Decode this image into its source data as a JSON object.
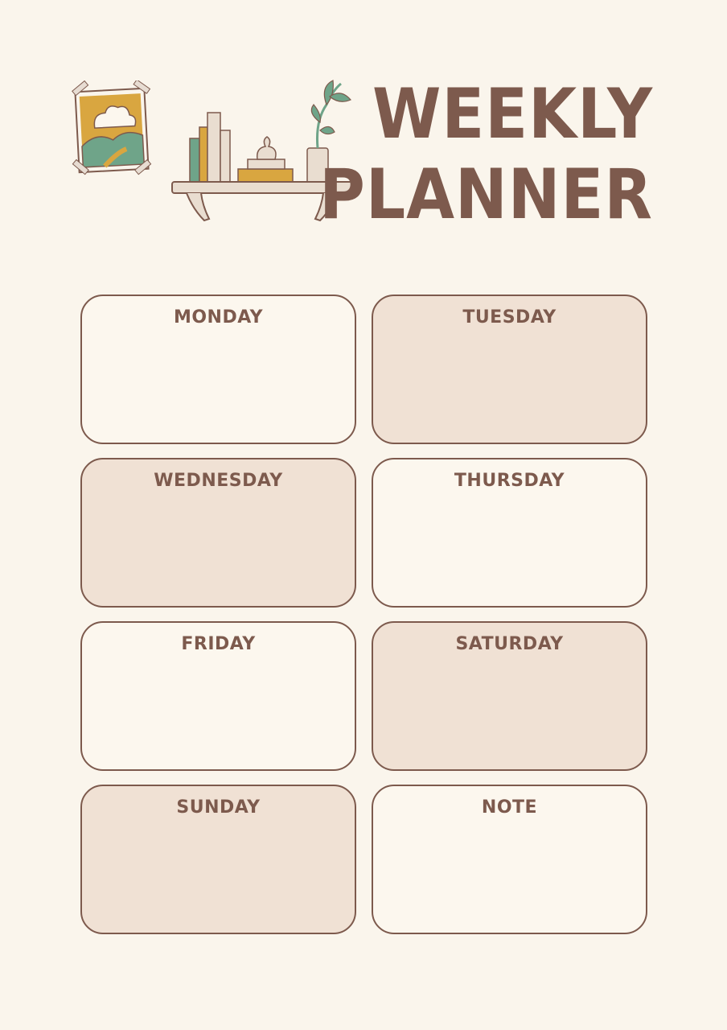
{
  "header": {
    "title_line1": "WEEKLY",
    "title_line2": "PLANNER"
  },
  "decorations": {
    "frame_icon": "framed-landscape-picture-icon",
    "shelf_icon": "bookshelf-with-plant-icon"
  },
  "days": [
    {
      "label": "MONDAY",
      "shaded": false
    },
    {
      "label": "TUESDAY",
      "shaded": true
    },
    {
      "label": "WEDNESDAY",
      "shaded": true
    },
    {
      "label": "THURSDAY",
      "shaded": false
    },
    {
      "label": "FRIDAY",
      "shaded": false
    },
    {
      "label": "SATURDAY",
      "shaded": true
    },
    {
      "label": "SUNDAY",
      "shaded": true
    },
    {
      "label": "NOTE",
      "shaded": false
    }
  ],
  "colors": {
    "background": "#faf5ec",
    "ink": "#7d5a4d",
    "card_light": "#fcf7ee",
    "card_shaded": "#f0e1d4",
    "mustard": "#d9a640",
    "sage": "#6fa489"
  }
}
